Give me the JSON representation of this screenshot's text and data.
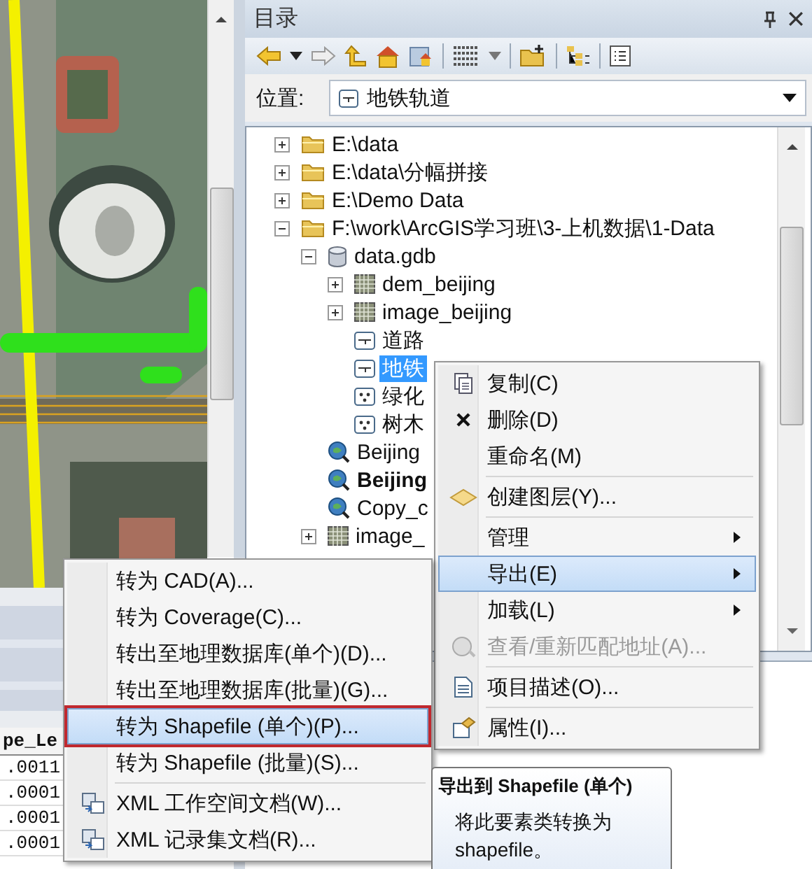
{
  "attribute_table": {
    "header": "pe_Le",
    "rows": [
      [
        ".0011"
      ],
      [
        ".0001"
      ],
      [
        ".0001"
      ],
      [
        ".0001"
      ]
    ]
  },
  "catalog": {
    "title": "目录",
    "location": {
      "label": "位置:",
      "value": "地铁轨道"
    },
    "tree": [
      {
        "label": "E:\\data",
        "kind": "folder",
        "expanded": false,
        "selected": false,
        "bold": false
      },
      {
        "label": "E:\\data\\分幅拼接",
        "kind": "folder",
        "expanded": false,
        "selected": false,
        "bold": false
      },
      {
        "label": "E:\\Demo Data",
        "kind": "folder",
        "expanded": false,
        "selected": false,
        "bold": false
      },
      {
        "label": "F:\\work\\ArcGIS学习班\\3-上机数据\\1-Data",
        "kind": "folder",
        "expanded": true,
        "selected": false,
        "bold": false,
        "children": [
          {
            "label": "data.gdb",
            "kind": "gdb",
            "expanded": true,
            "selected": false,
            "bold": false,
            "children": [
              {
                "label": "dem_beijing",
                "kind": "raster",
                "expanded": false,
                "selected": false,
                "bold": false
              },
              {
                "label": "image_beijing",
                "kind": "raster",
                "expanded": false,
                "selected": false,
                "bold": false
              },
              {
                "label": "道路",
                "kind": "line",
                "selected": false,
                "bold": false
              },
              {
                "label": "地铁",
                "kind": "line",
                "selected": true,
                "bold": false
              },
              {
                "label": "绿化",
                "kind": "point",
                "selected": false,
                "bold": false
              },
              {
                "label": "树木",
                "kind": "point",
                "selected": false,
                "bold": false
              }
            ]
          },
          {
            "label": "Beijing",
            "kind": "locator",
            "selected": false,
            "bold": false
          },
          {
            "label": "Beijing",
            "kind": "locator",
            "selected": false,
            "bold": true
          },
          {
            "label": "Copy_c",
            "kind": "locator",
            "selected": false,
            "bold": false
          },
          {
            "label": "image_",
            "kind": "raster",
            "expanded": false,
            "selected": false,
            "bold": false
          }
        ]
      }
    ]
  },
  "context_menu": [
    {
      "kind": "item",
      "label": "复制(C)",
      "selected": false,
      "disabled": false,
      "submenu": false
    },
    {
      "kind": "item",
      "label": "删除(D)",
      "selected": false,
      "disabled": false,
      "submenu": false
    },
    {
      "kind": "item",
      "label": "重命名(M)",
      "selected": false,
      "disabled": false,
      "submenu": false
    },
    {
      "kind": "separator"
    },
    {
      "kind": "item",
      "label": "创建图层(Y)...",
      "selected": false,
      "disabled": false,
      "submenu": false
    },
    {
      "kind": "separator"
    },
    {
      "kind": "item",
      "label": "管理",
      "selected": false,
      "disabled": false,
      "submenu": true
    },
    {
      "kind": "item",
      "label": "导出(E)",
      "selected": true,
      "disabled": false,
      "submenu": true
    },
    {
      "kind": "item",
      "label": "加载(L)",
      "selected": false,
      "disabled": false,
      "submenu": true
    },
    {
      "kind": "item",
      "label": "查看/重新匹配地址(A)...",
      "selected": false,
      "disabled": true,
      "submenu": false
    },
    {
      "kind": "separator"
    },
    {
      "kind": "item",
      "label": "项目描述(O)...",
      "selected": false,
      "disabled": false,
      "submenu": false
    },
    {
      "kind": "separator"
    },
    {
      "kind": "item",
      "label": "属性(I)...",
      "selected": false,
      "disabled": false,
      "submenu": false
    }
  ],
  "export_submenu": [
    {
      "kind": "item",
      "label": "转为 CAD(A)...",
      "selected": false,
      "outlined": false
    },
    {
      "kind": "item",
      "label": "转为 Coverage(C)...",
      "selected": false,
      "outlined": false
    },
    {
      "kind": "item",
      "label": "转出至地理数据库(单个)(D)...",
      "selected": false,
      "outlined": false
    },
    {
      "kind": "item",
      "label": "转出至地理数据库(批量)(G)...",
      "selected": false,
      "outlined": false
    },
    {
      "kind": "item",
      "label": "转为 Shapefile (单个)(P)...",
      "selected": true,
      "outlined": true
    },
    {
      "kind": "item",
      "label": "转为 Shapefile (批量)(S)...",
      "selected": false,
      "outlined": false
    },
    {
      "kind": "separator"
    },
    {
      "kind": "item",
      "label": "XML 工作空间文档(W)...",
      "selected": false,
      "outlined": false
    },
    {
      "kind": "item",
      "label": "XML 记录集文档(R)...",
      "selected": false,
      "outlined": false
    }
  ],
  "tooltip": {
    "title": "导出到 Shapefile (单个)",
    "text": "将此要素类转换为 shapefile。"
  }
}
